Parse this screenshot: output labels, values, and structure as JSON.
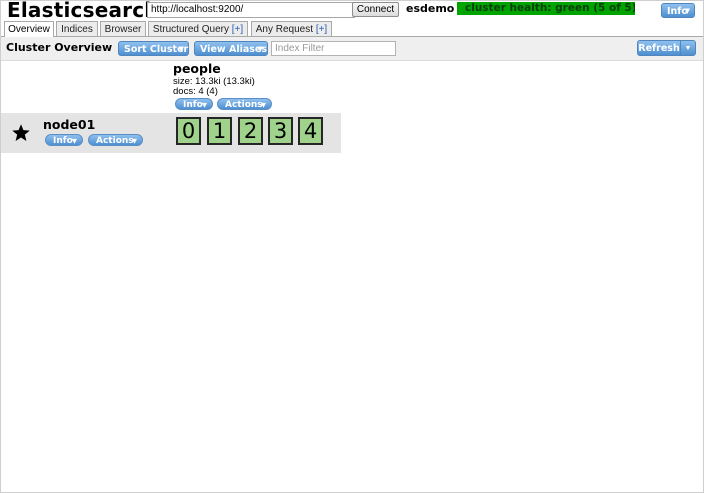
{
  "app": {
    "title": "Elasticsearch"
  },
  "connection": {
    "url_value": "http://localhost:9200/",
    "connect_label": "Connect",
    "cluster_name": "esdemo",
    "health_text": "cluster health: green (5 of 5)",
    "health_color": "#00a400",
    "info_label": "Info"
  },
  "tabs": [
    {
      "label": "Overview",
      "active": true
    },
    {
      "label": "Indices",
      "active": false
    },
    {
      "label": "Browser",
      "active": false
    },
    {
      "label": "Structured Query",
      "plus": "[+]",
      "active": false
    },
    {
      "label": "Any Request",
      "plus": "[+]",
      "active": false
    }
  ],
  "toolbar": {
    "title": "Cluster Overview",
    "sort_cluster_label": "Sort Cluster",
    "view_aliases_label": "View Aliases",
    "index_filter_placeholder": "Index Filter",
    "refresh_label": "Refresh"
  },
  "index": {
    "name": "people",
    "size_text": "size: 13.3ki (13.3ki)",
    "docs_text": "docs: 4 (4)",
    "info_label": "Info",
    "actions_label": "Actions"
  },
  "node": {
    "name": "node01",
    "is_master_icon": "star-icon",
    "info_label": "Info",
    "actions_label": "Actions",
    "shards": [
      "0",
      "1",
      "2",
      "3",
      "4"
    ],
    "shard_color": "#9fd28a"
  },
  "accent_blue": "#4f8fd0"
}
